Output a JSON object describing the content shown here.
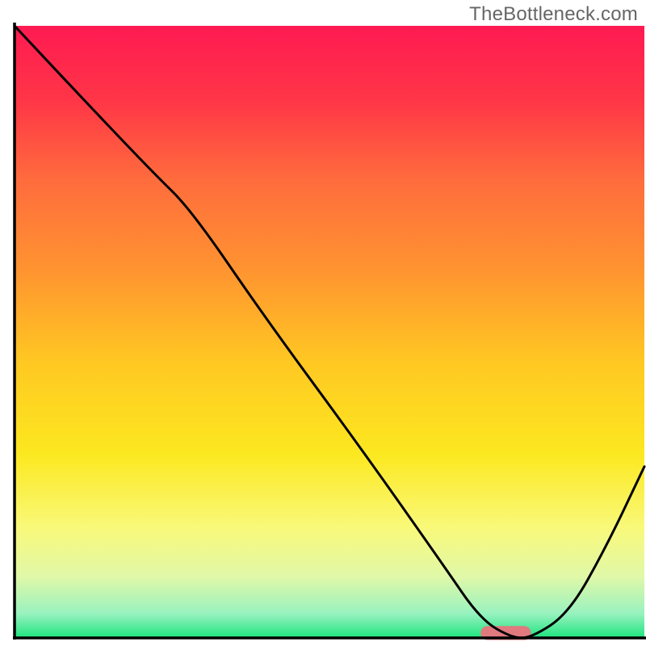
{
  "watermark": "TheBottleneck.com",
  "chart_data": {
    "type": "line",
    "title": "",
    "xlabel": "",
    "ylabel": "",
    "xlim": [
      0,
      100
    ],
    "ylim": [
      0,
      100
    ],
    "background_gradient": {
      "stops": [
        {
          "offset": 0.0,
          "color": "#FF1A52"
        },
        {
          "offset": 0.12,
          "color": "#FF3547"
        },
        {
          "offset": 0.25,
          "color": "#FF6B3D"
        },
        {
          "offset": 0.4,
          "color": "#FF9430"
        },
        {
          "offset": 0.55,
          "color": "#FFC822"
        },
        {
          "offset": 0.7,
          "color": "#FCE820"
        },
        {
          "offset": 0.82,
          "color": "#F9F97A"
        },
        {
          "offset": 0.9,
          "color": "#E0F8A8"
        },
        {
          "offset": 0.96,
          "color": "#99F2BF"
        },
        {
          "offset": 1.0,
          "color": "#1DE47F"
        }
      ]
    },
    "series": [
      {
        "name": "bottleneck-curve",
        "color": "#000000",
        "x": [
          0,
          10,
          22,
          28,
          40,
          55,
          68,
          74,
          79,
          82,
          88,
          94,
          100
        ],
        "y": [
          100,
          89,
          76,
          70,
          52,
          31,
          12,
          3,
          0,
          0,
          4,
          15,
          28
        ]
      }
    ],
    "marker": {
      "name": "optimal-range",
      "color": "#E07A7F",
      "x_start": 74,
      "x_end": 82,
      "y": 0.8,
      "thickness": 2.3
    },
    "axes": {
      "frame_color": "#000000",
      "frame_width": 3.5,
      "show_left": true,
      "show_bottom": true,
      "show_top": false,
      "show_right": false
    }
  }
}
